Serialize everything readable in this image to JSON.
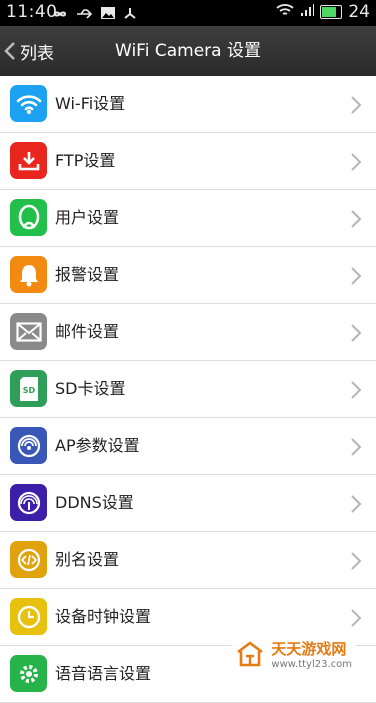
{
  "statusbar": {
    "time": "11:40",
    "battery": "24"
  },
  "header": {
    "back_label": "列表",
    "title": "WiFi Camera 设置"
  },
  "items": [
    {
      "label": "Wi-Fi设置",
      "color": "#1da1f2",
      "icon": "wifi-icon"
    },
    {
      "label": "FTP设置",
      "color": "#e8261f",
      "icon": "download-icon"
    },
    {
      "label": "用户设置",
      "color": "#22c04a",
      "icon": "user-icon"
    },
    {
      "label": "报警设置",
      "color": "#f28a12",
      "icon": "bell-icon"
    },
    {
      "label": "邮件设置",
      "color": "#8a8a8a",
      "icon": "mail-icon"
    },
    {
      "label": "SD卡设置",
      "color": "#2e9e58",
      "icon": "sd-card-icon"
    },
    {
      "label": "AP参数设置",
      "color": "#3a57b8",
      "icon": "ap-icon"
    },
    {
      "label": "DDNS设置",
      "color": "#3c1fa8",
      "icon": "ddns-icon"
    },
    {
      "label": "别名设置",
      "color": "#e0a30e",
      "icon": "code-icon"
    },
    {
      "label": "设备时钟设置",
      "color": "#e8c10f",
      "icon": "clock-icon"
    },
    {
      "label": "语音语言设置",
      "color": "#26b34a",
      "icon": "gear-icon"
    }
  ],
  "watermark": {
    "name": "天天游戏网",
    "url": "www.ttyl23.com"
  }
}
